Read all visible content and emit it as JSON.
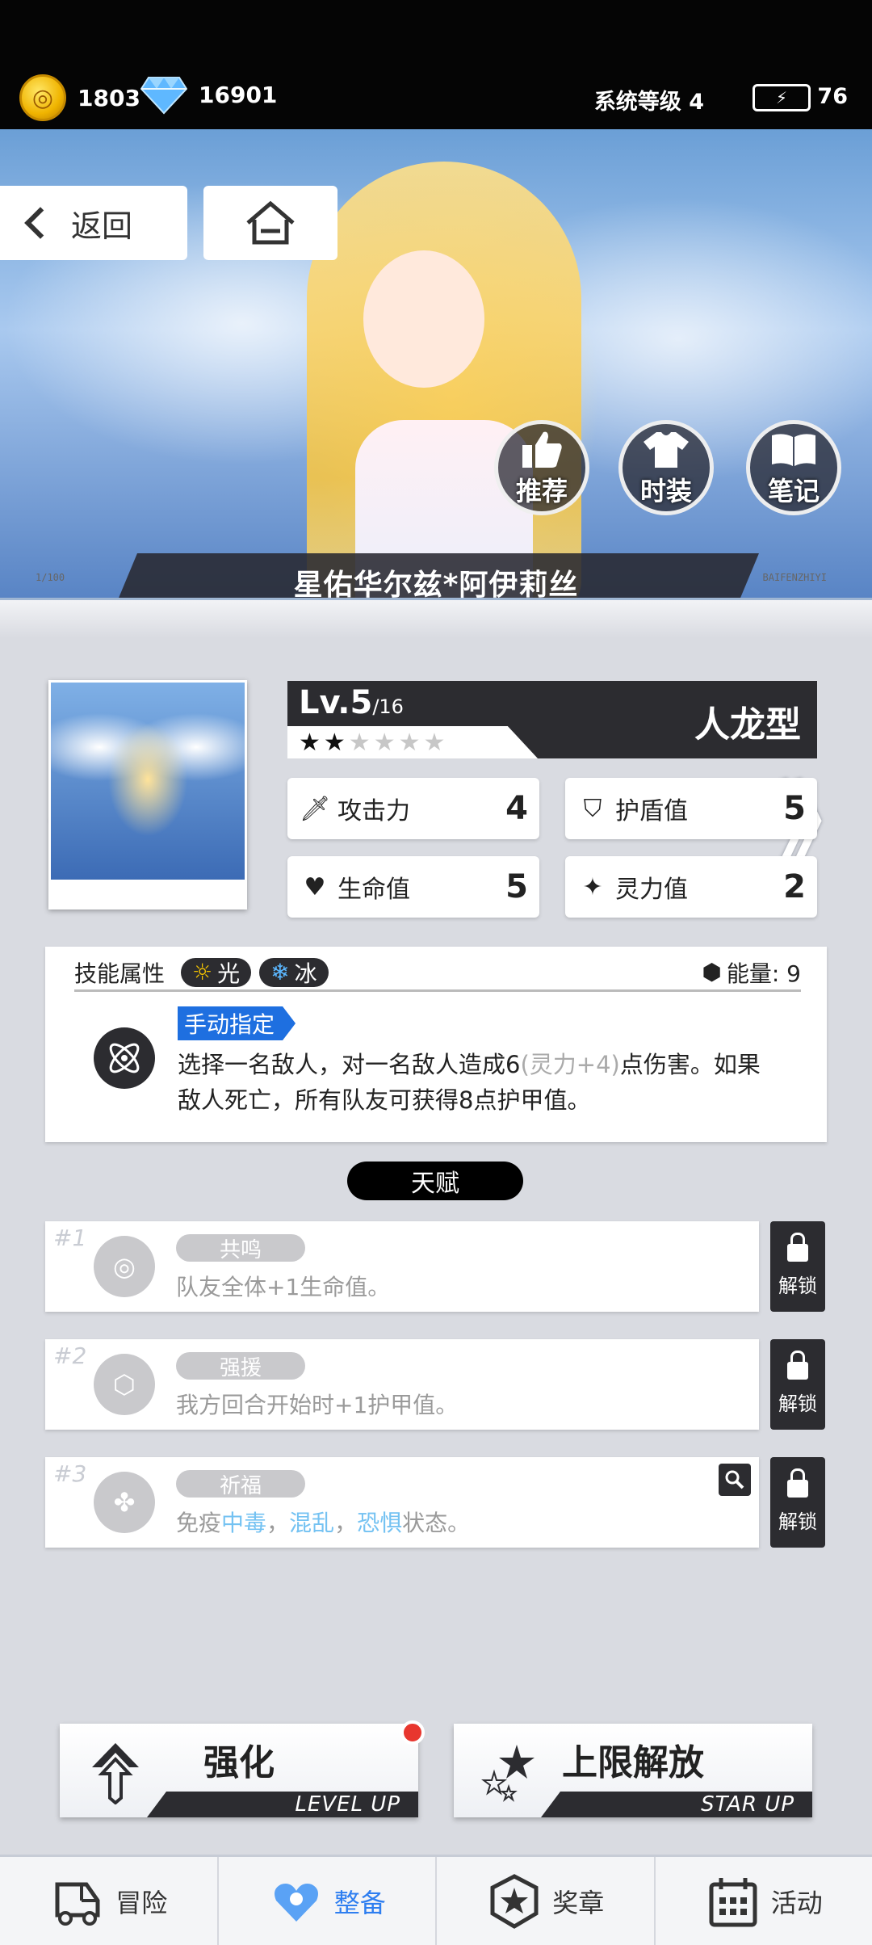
{
  "topbar": {
    "coins": "1803",
    "gems": "16901",
    "system_level": "系统等级 4",
    "energy": "76"
  },
  "banner": {
    "back_label": "返回",
    "character_name": "星佑华尔兹*阿伊莉丝",
    "buttons": [
      {
        "label": "推荐",
        "icon": "thumbs-up-icon"
      },
      {
        "label": "时装",
        "icon": "shirt-icon"
      },
      {
        "label": "笔记",
        "icon": "book-icon"
      }
    ],
    "deco_left": "1/100",
    "deco_right": "BAIFENZHIYI"
  },
  "card": {
    "level": "Lv.5",
    "level_max": "/16",
    "stars_on": "★★",
    "stars_off": "★★★★",
    "type": "人龙型",
    "stats": [
      {
        "label": "攻击力",
        "value": "4",
        "icon": "sword-icon"
      },
      {
        "label": "护盾值",
        "value": "5",
        "icon": "shield-icon"
      },
      {
        "label": "生命值",
        "value": "5",
        "icon": "heart-icon"
      },
      {
        "label": "灵力值",
        "value": "2",
        "icon": "sparkle-icon"
      }
    ]
  },
  "skill": {
    "attr_label": "技能属性",
    "tags": [
      "光",
      "冰"
    ],
    "energy": "能量: 9",
    "mode": "手动指定",
    "desc_a": "选择一名敌人，对一名敌人造成6",
    "desc_dim": "(灵力+4)",
    "desc_b": "点伤害。如果",
    "desc_line2": "敌人死亡，所有队友可获得8点护甲值。"
  },
  "talents": {
    "title": "天赋",
    "unlock_label": "解锁",
    "items": [
      {
        "num": "#1",
        "name": "共鸣",
        "desc": "队友全体+1生命值。"
      },
      {
        "num": "#2",
        "name": "强援",
        "desc": "我方回合开始时+1护甲值。"
      },
      {
        "num": "#3",
        "name": "祈福",
        "desc_a": "免疫",
        "c1": "中毒",
        "sep1": "，",
        "c2": "混乱",
        "sep2": "，",
        "c3": "恐惧",
        "desc_b": "状态。"
      }
    ]
  },
  "actions": {
    "levelup": {
      "label": "强化",
      "sub": "LEVEL UP"
    },
    "starup": {
      "label": "上限解放",
      "sub": "STAR UP"
    }
  },
  "nav": [
    {
      "label": "冒险",
      "icon": "truck-icon"
    },
    {
      "label": "整备",
      "icon": "heart-gear-icon"
    },
    {
      "label": "奖章",
      "icon": "star-badge-icon"
    },
    {
      "label": "活动",
      "icon": "calendar-icon"
    }
  ],
  "colors": {
    "accent": "#2e7ef0",
    "dark": "#2c2c30",
    "badge": "#e8362e"
  }
}
